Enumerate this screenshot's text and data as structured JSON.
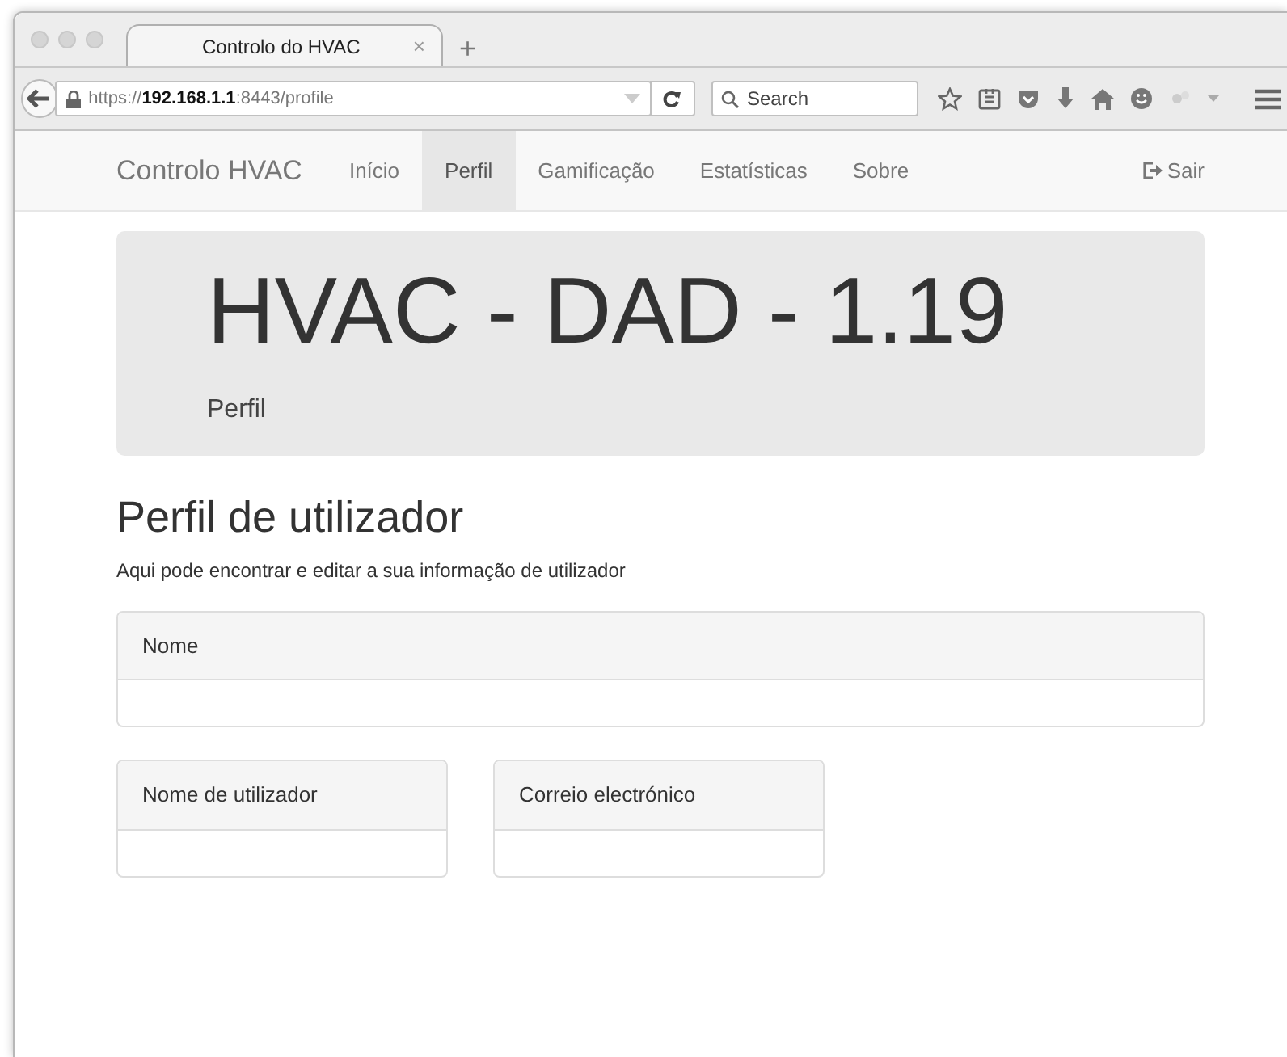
{
  "browser": {
    "tab_title": "Controlo do HVAC",
    "tab_close": "×",
    "new_tab": "+",
    "url": "https://**192.168.1.1**:8443/profile",
    "search": {
      "placeholder": "Search"
    }
  },
  "navbar": {
    "brand": "Controlo HVAC",
    "items": [
      {
        "label": "Início",
        "selected": false
      },
      {
        "label": "Perfil",
        "selected": true
      },
      {
        "label": "Gamificação",
        "selected": false
      },
      {
        "label": "Estatísticas",
        "selected": false
      },
      {
        "label": "Sobre",
        "selected": false
      }
    ],
    "logout": "Sair"
  },
  "jumbotron": {
    "title": "HVAC - DAD - 1.19",
    "subtitle": "Perfil"
  },
  "heading": "Perfil de utilizador",
  "description": "Aqui pode encontrar e editar a sua informação de utilizador",
  "panels": [
    {
      "title": "Nome",
      "wide": true
    },
    {
      "title": "Nome de utilizador",
      "wide": false
    },
    {
      "title": "Correio electrónico",
      "wide": false
    }
  ]
}
